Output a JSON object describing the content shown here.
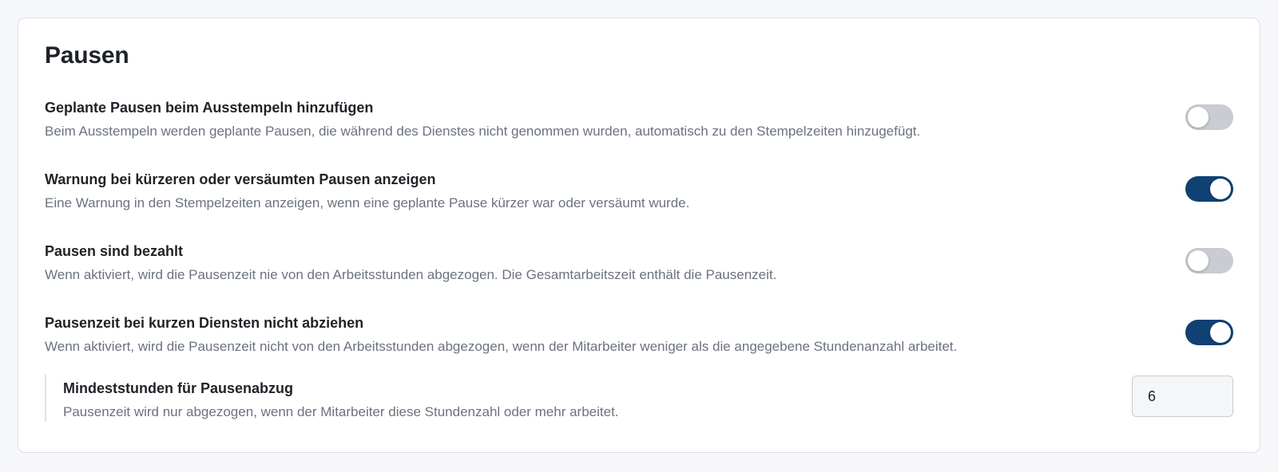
{
  "section": {
    "title": "Pausen"
  },
  "settings": [
    {
      "label": "Geplante Pausen beim Ausstempeln hinzufügen",
      "description": "Beim Ausstempeln werden geplante Pausen, die während des Dienstes nicht genommen wurden, automatisch zu den Stempelzeiten hinzugefügt.",
      "enabled": false
    },
    {
      "label": "Warnung bei kürzeren oder versäumten Pausen anzeigen",
      "description": "Eine Warnung in den Stempelzeiten anzeigen, wenn eine geplante Pause kürzer war oder versäumt wurde.",
      "enabled": true
    },
    {
      "label": "Pausen sind bezahlt",
      "description": "Wenn aktiviert, wird die Pausenzeit nie von den Arbeitsstunden abgezogen. Die Gesamtarbeitszeit enthält die Pausenzeit.",
      "enabled": false
    },
    {
      "label": "Pausenzeit bei kurzen Diensten nicht abziehen",
      "description": "Wenn aktiviert, wird die Pausenzeit nicht von den Arbeitsstunden abgezogen, wenn der Mitarbeiter weniger als die angegebene Stundenanzahl arbeitet.",
      "enabled": true
    }
  ],
  "min_hours": {
    "label": "Mindeststunden für Pausenabzug",
    "description": "Pausenzeit wird nur abgezogen, wenn der Mitarbeiter diese Stundenzahl oder mehr arbeitet.",
    "value": "6"
  },
  "colors": {
    "toggle_on": "#0f4273",
    "toggle_off": "#c9ccd3",
    "text_primary": "#1f2328",
    "text_secondary": "#6b7280"
  }
}
